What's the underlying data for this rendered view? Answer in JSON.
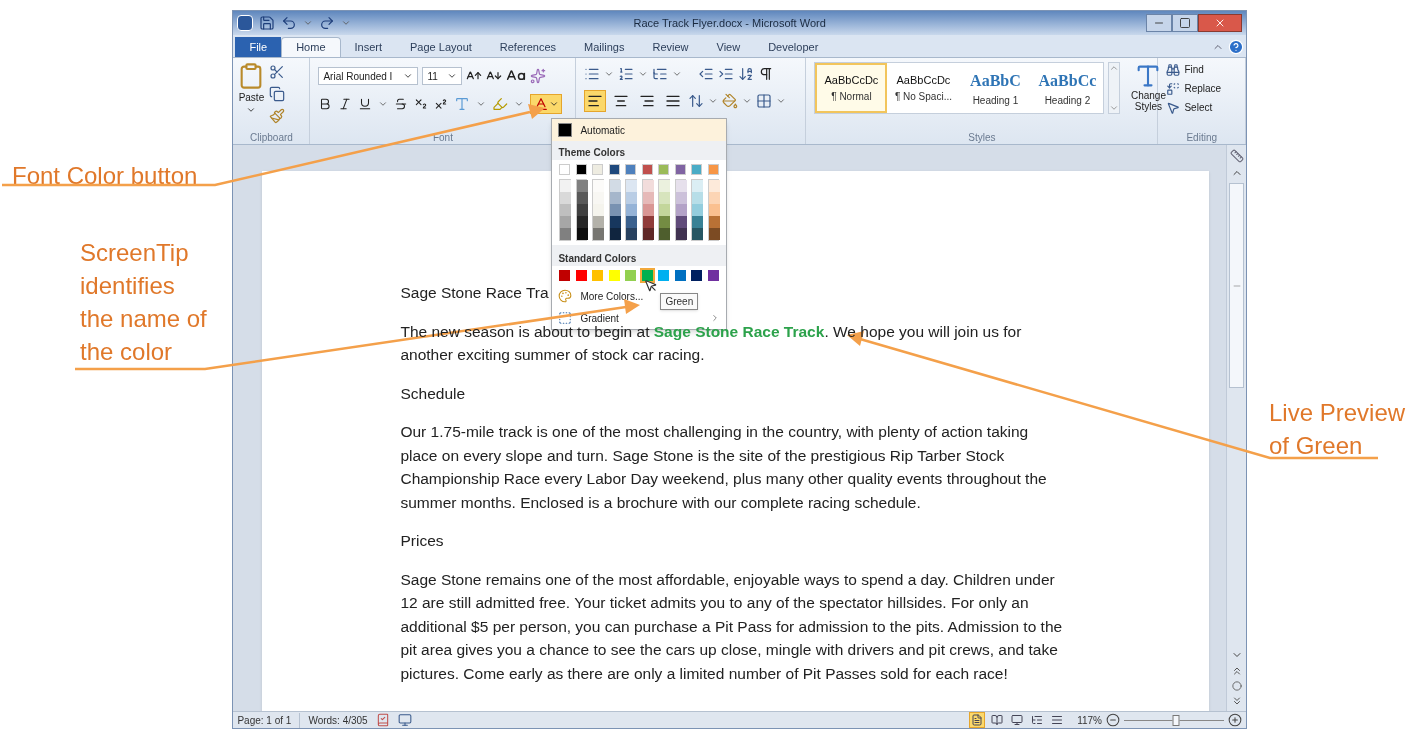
{
  "callouts": [
    {
      "text": "Font Color button"
    },
    {
      "text": "ScreenTip identifies the name of the color"
    },
    {
      "text": "Live Preview of Green"
    }
  ],
  "window": {
    "title": "Race Track Flyer.docx - Microsoft Word"
  },
  "tabs": [
    {
      "label": "File",
      "kind": "file",
      "selected": false
    },
    {
      "label": "Home",
      "kind": "tab",
      "selected": true
    },
    {
      "label": "Insert",
      "kind": "tab",
      "selected": false
    },
    {
      "label": "Page Layout",
      "kind": "tab",
      "selected": false
    },
    {
      "label": "References",
      "kind": "tab",
      "selected": false
    },
    {
      "label": "Mailings",
      "kind": "tab",
      "selected": false
    },
    {
      "label": "Review",
      "kind": "tab",
      "selected": false
    },
    {
      "label": "View",
      "kind": "tab",
      "selected": false
    },
    {
      "label": "Developer",
      "kind": "tab",
      "selected": false
    }
  ],
  "ribbon": {
    "paste_label": "Paste",
    "font_name": "Arial Rounded I",
    "font_size": "11",
    "font_color_open": true,
    "align_buttons": [
      {
        "kind": "left",
        "selected": true
      },
      {
        "kind": "center",
        "selected": false
      },
      {
        "kind": "right",
        "selected": false
      },
      {
        "kind": "justify",
        "selected": false
      }
    ],
    "styles": [
      {
        "preview": "AaBbCcDc",
        "name": "¶ Normal",
        "kind": "body",
        "selected": true
      },
      {
        "preview": "AaBbCcDc",
        "name": "¶ No Spaci...",
        "kind": "body",
        "selected": false
      },
      {
        "preview": "AaBbC",
        "name": "Heading 1",
        "kind": "heading",
        "selected": false
      },
      {
        "preview": "AaBbCc",
        "name": "Heading 2",
        "kind": "heading",
        "selected": false
      }
    ],
    "change_styles": "Change Styles",
    "editing": [
      "Find",
      "Replace",
      "Select"
    ],
    "group_labels": {
      "clipboard": "Clipboard",
      "font": "Font",
      "styles": "Styles",
      "editing": "Editing"
    }
  },
  "font_color_menu": {
    "automatic": "Automatic",
    "theme_label": "Theme Colors",
    "theme_colors": [
      {
        "color": "#ffffff"
      },
      {
        "color": "#000000"
      },
      {
        "color": "#eeece1"
      },
      {
        "color": "#1f497d"
      },
      {
        "color": "#4f81bd"
      },
      {
        "color": "#c0504d"
      },
      {
        "color": "#9bbb59"
      },
      {
        "color": "#8064a2"
      },
      {
        "color": "#4bacc6"
      },
      {
        "color": "#f79646"
      }
    ],
    "standard_label": "Standard Colors",
    "standard_colors": [
      {
        "color": "#c00000",
        "selected": false
      },
      {
        "color": "#ff0000",
        "selected": false
      },
      {
        "color": "#ffc000",
        "selected": false
      },
      {
        "color": "#ffff00",
        "selected": false
      },
      {
        "color": "#92d050",
        "selected": false
      },
      {
        "color": "#00b050",
        "selected": true
      },
      {
        "color": "#00b0f0",
        "selected": false
      },
      {
        "color": "#0070c0",
        "selected": false
      },
      {
        "color": "#002060",
        "selected": false
      },
      {
        "color": "#7030a0",
        "selected": false
      }
    ],
    "more_colors": "More Colors...",
    "gradient": "Gradient",
    "screentip": "Green"
  },
  "document": {
    "paragraphs": [
      "Sage Stone Race Tra",
      "The new season is about to begin at **Sage Stone Race Track**. We hope you will join us for another exciting summer of stock car racing.",
      "Schedule",
      "Our 1.75-mile track is one of the most challenging in the country, with plenty of action taking place on every slope and turn. Sage Stone is the site of the prestigious Rip Tarber Stock Championship Race every Labor Day weekend, plus many other quality events throughout the summer months. Enclosed is a brochure with our complete racing schedule.",
      "Prices",
      "Sage Stone remains one of the most affordable, enjoyable ways to spend a day. Children under 12 are still admitted free. Your ticket admits you to any of the spectator hillsides. For only an additional $5 per person, you can purchase a Pit Pass for admission to the pits. Admission to the pit area gives you a chance to see the cars up close, mingle with drivers and pit crews, and take pictures. Come early as there are only a limited number of Pit Passes sold for each race!"
    ]
  },
  "status_bar": {
    "page": "Page: 1 of 1",
    "words": "Words: 4/305",
    "zoom": "117%",
    "zoom_slider": {
      "level": 0.52
    },
    "views": [
      {
        "selected": true
      },
      {
        "selected": false
      },
      {
        "selected": false
      },
      {
        "selected": false
      },
      {
        "selected": false
      }
    ]
  }
}
